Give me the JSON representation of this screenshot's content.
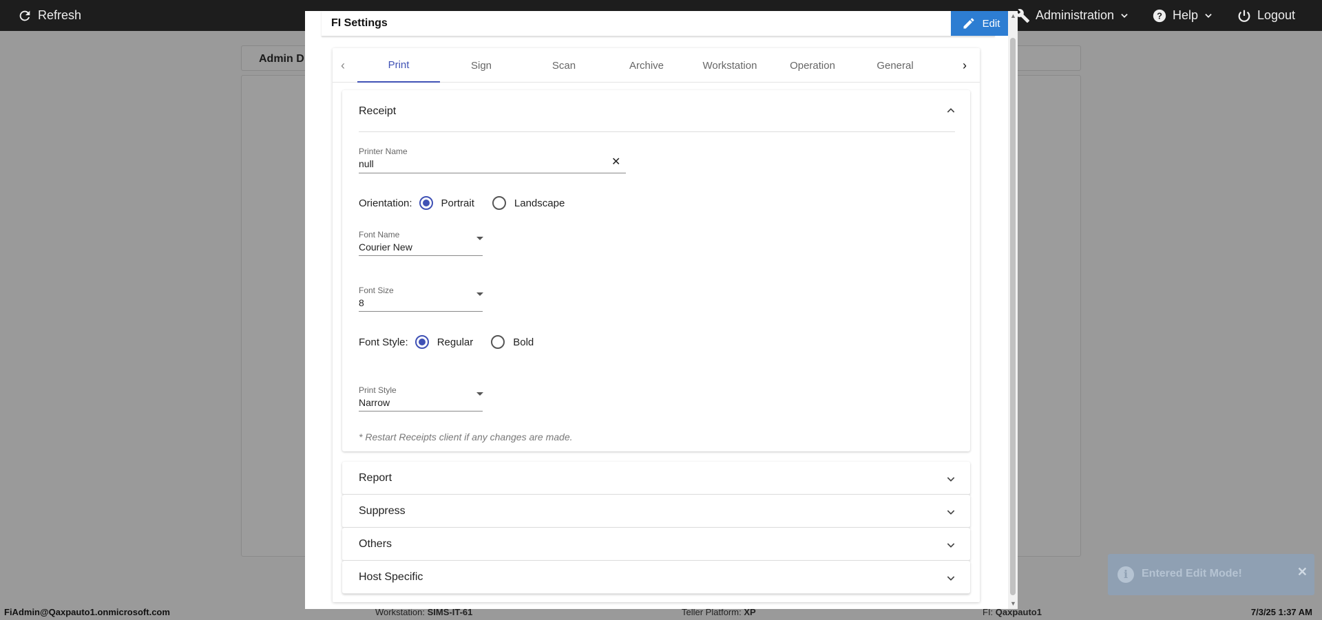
{
  "topbar": {
    "refresh_label": "Refresh",
    "administration_label": "Administration",
    "help_label": "Help",
    "logout_label": "Logout"
  },
  "background": {
    "header_title": "Admin D"
  },
  "modal": {
    "title": "FI Settings",
    "edit_label": "Edit",
    "tabs": [
      {
        "label": "Print",
        "active": true
      },
      {
        "label": "Sign"
      },
      {
        "label": "Scan"
      },
      {
        "label": "Archive"
      },
      {
        "label": "Workstation"
      },
      {
        "label": "Operation"
      },
      {
        "label": "General"
      }
    ],
    "receipt": {
      "title": "Receipt",
      "printer_name": {
        "label": "Printer Name",
        "value": "null"
      },
      "orientation": {
        "label": "Orientation:",
        "options": [
          "Portrait",
          "Landscape"
        ],
        "selected": "Portrait"
      },
      "font_name": {
        "label": "Font Name",
        "value": "Courier New"
      },
      "font_size": {
        "label": "Font Size",
        "value": "8"
      },
      "font_style": {
        "label": "Font Style:",
        "options": [
          "Regular",
          "Bold"
        ],
        "selected": "Regular"
      },
      "print_style": {
        "label": "Print Style",
        "value": "Narrow"
      },
      "note": "* Restart Receipts client if any changes are made."
    },
    "sections": [
      {
        "title": "Report"
      },
      {
        "title": "Suppress"
      },
      {
        "title": "Others"
      },
      {
        "title": "Host Specific"
      }
    ]
  },
  "statusbar": {
    "user": "FiAdmin@Qaxpauto1.onmicrosoft.com",
    "workstation_label": "Workstation:",
    "workstation_value": "SIMS-IT-61",
    "teller_label": "Teller Platform:",
    "teller_value": "XP",
    "fi_label": "FI:",
    "fi_value": "Qaxpauto1",
    "datetime": "7/3/25 1:37 AM"
  },
  "toast": {
    "message": "Entered Edit Mode!"
  },
  "colors": {
    "accent": "#3f51b5",
    "edit_button": "#2d7dd2",
    "topbar": "#1d1d1d"
  }
}
